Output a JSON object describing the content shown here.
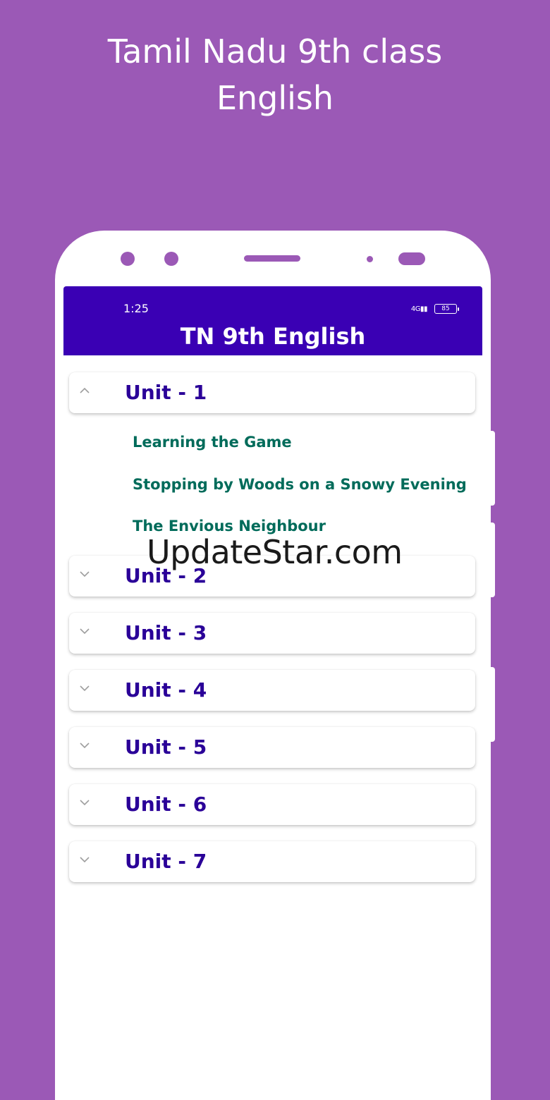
{
  "promo": {
    "title_line1": "Tamil Nadu 9th class",
    "title_line2": "English"
  },
  "status_bar": {
    "time": "1:25",
    "network": "4G",
    "battery": "85"
  },
  "app_bar": {
    "title": "TN 9th English"
  },
  "units": [
    {
      "label": "Unit - 1",
      "expanded": true
    },
    {
      "label": "Unit - 2",
      "expanded": false
    },
    {
      "label": "Unit - 3",
      "expanded": false
    },
    {
      "label": "Unit - 4",
      "expanded": false
    },
    {
      "label": "Unit - 5",
      "expanded": false
    },
    {
      "label": "Unit - 6",
      "expanded": false
    },
    {
      "label": "Unit - 7",
      "expanded": false
    }
  ],
  "unit1_lessons": [
    "Learning the Game",
    "Stopping by Woods on a Snowy Evening",
    "The Envious Neighbour"
  ],
  "watermark": "UpdateStar.com",
  "colors": {
    "background": "#9b59b6",
    "app_bar": "#3a00b4",
    "unit_text": "#2a0098",
    "lesson_text": "#006b5a"
  },
  "icons": {
    "expanded": "chevron-up-icon",
    "collapsed": "chevron-down-icon"
  }
}
